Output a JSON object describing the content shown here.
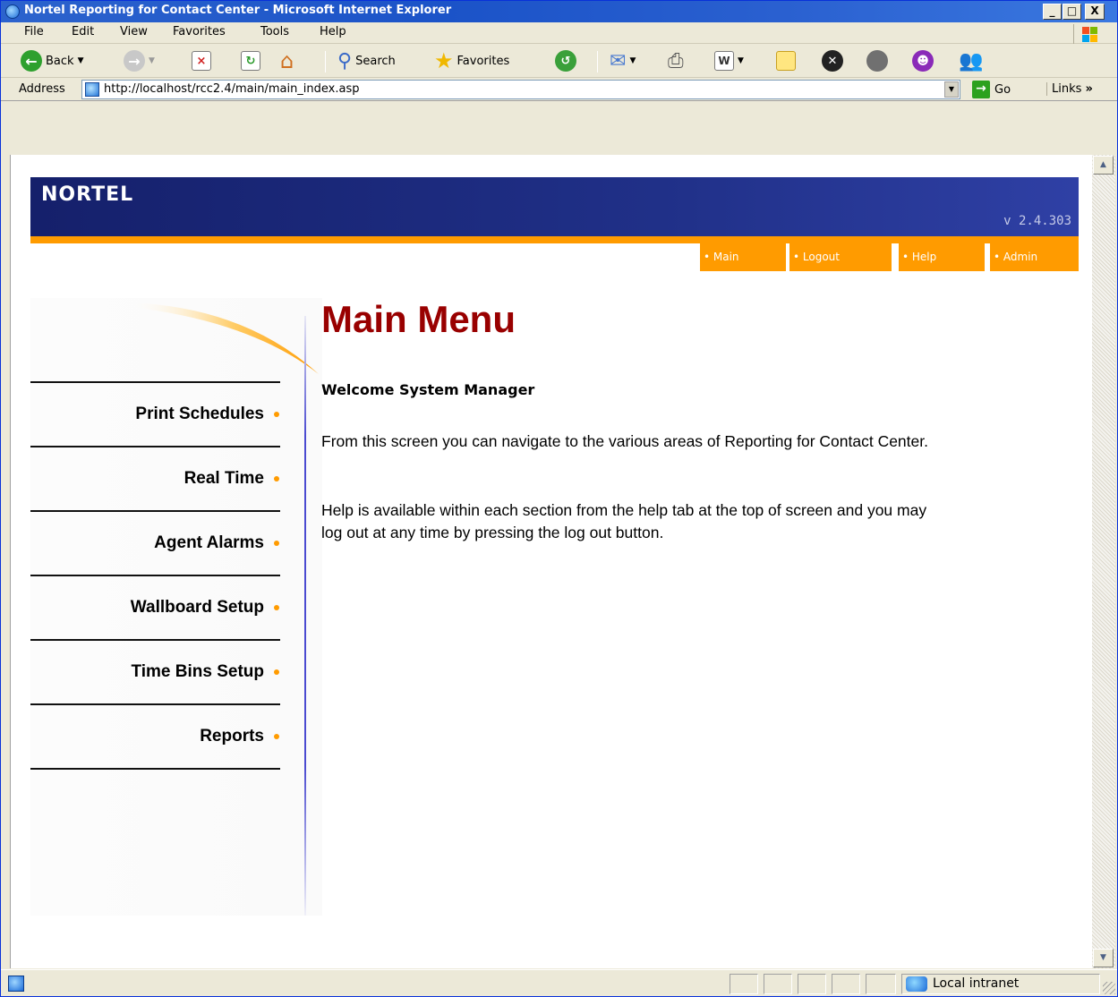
{
  "window": {
    "title": "Nortel Reporting for Contact Center - Microsoft Internet Explorer",
    "caption_buttons": {
      "minimize": "_",
      "maximize": "□",
      "close": "X"
    }
  },
  "menu": [
    "File",
    "Edit",
    "View",
    "Favorites",
    "Tools",
    "Help"
  ],
  "toolbar": {
    "back": "Back",
    "search": "Search",
    "favorites": "Favorites"
  },
  "address": {
    "label": "Address",
    "url": "http://localhost/rcc2.4/main/main_index.asp",
    "go": "Go",
    "links": "Links"
  },
  "page": {
    "logo": "NORTEL",
    "version": "v 2.4.303",
    "top_nav": [
      {
        "label": "• Main"
      },
      {
        "label": "• Logout"
      },
      {
        "label": "• Help"
      },
      {
        "label": "• Admin"
      }
    ],
    "title": "Main Menu",
    "welcome": "Welcome System Manager",
    "paragraph1": "From this screen you can navigate to the various areas of Reporting for Contact Center.",
    "paragraph2": "Help is available within each section from the help tab at the top of screen and you may log out at any time by pressing the log out button.",
    "side_nav": [
      {
        "label": "Print Schedules"
      },
      {
        "label": "Real Time"
      },
      {
        "label": "Agent Alarms"
      },
      {
        "label": "Wallboard Setup"
      },
      {
        "label": "Time Bins Setup"
      },
      {
        "label": "Reports"
      }
    ]
  },
  "status": {
    "zone": "Local intranet"
  },
  "colors": {
    "banner_blue": "#1b2a80",
    "accent_orange": "#ff9b00",
    "title_red": "#990000"
  }
}
